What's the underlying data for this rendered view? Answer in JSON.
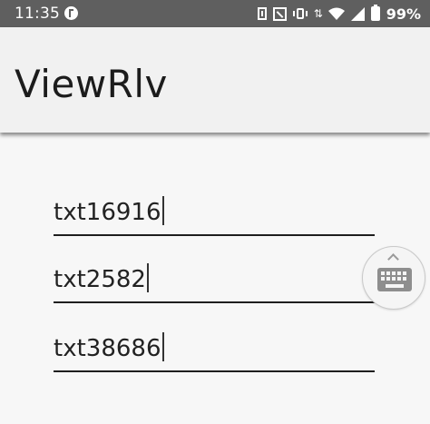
{
  "status_bar": {
    "time": "11:35",
    "battery_percent": "99%",
    "icons": [
      "f-app-icon",
      "sim-icon",
      "nfc-icon",
      "vibrate-icon",
      "data-arrows-icon",
      "wifi-icon",
      "signal-icon",
      "battery-icon"
    ]
  },
  "app_bar": {
    "title": "ViewRlv"
  },
  "fields": [
    {
      "value": "txt16916"
    },
    {
      "value": "txt2582"
    },
    {
      "value": "txt38686"
    }
  ],
  "colors": {
    "status_bar": "#5f5f5f",
    "app_bar": "#f1f1f1",
    "background": "#f7f7f7",
    "underline": "#1e1e1e"
  }
}
